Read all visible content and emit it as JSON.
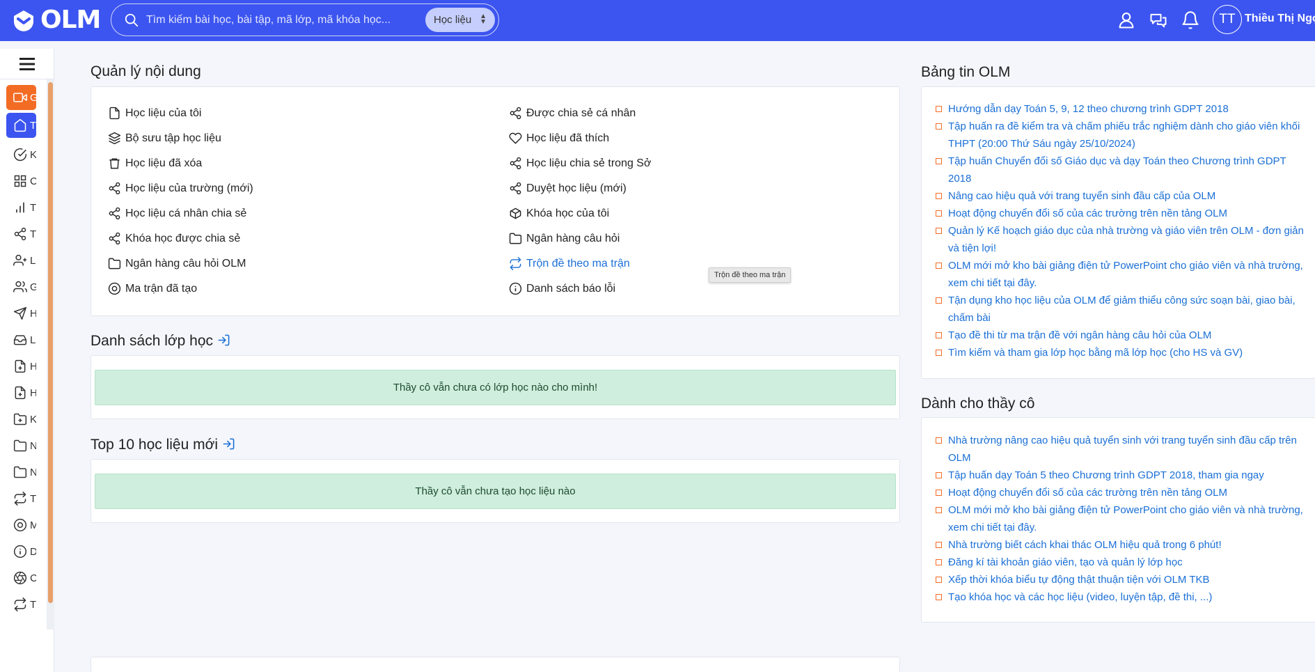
{
  "header": {
    "logo_text": "OLM",
    "search_placeholder": "Tìm kiếm bài học, bài tập, mã lớp, mã khóa học...",
    "search_scope": "Học liệu",
    "avatar_initials": "TT",
    "username": "Thiều Thị Ngọc"
  },
  "sidebar": {
    "items": [
      {
        "label": "G",
        "icon": "video-icon"
      },
      {
        "label": "T",
        "icon": "home-icon"
      },
      {
        "label": "K",
        "icon": "check-circle-icon"
      },
      {
        "label": "C",
        "icon": "grid-icon"
      },
      {
        "label": "T",
        "icon": "bar-chart-icon"
      },
      {
        "label": "T",
        "icon": "share-icon"
      },
      {
        "label": "L",
        "icon": "user-plus-icon"
      },
      {
        "label": "G",
        "icon": "users-icon"
      },
      {
        "label": "H",
        "icon": "send-icon"
      },
      {
        "label": "L",
        "icon": "inbox-icon"
      },
      {
        "label": "H",
        "icon": "file-plus-icon"
      },
      {
        "label": "H",
        "icon": "file-plus-icon"
      },
      {
        "label": "K",
        "icon": "folder-plus-icon"
      },
      {
        "label": "N",
        "icon": "folder-icon"
      },
      {
        "label": "N",
        "icon": "folder-icon"
      },
      {
        "label": "T",
        "icon": "shuffle-icon"
      },
      {
        "label": "M",
        "icon": "target-icon"
      },
      {
        "label": "D",
        "icon": "info-icon"
      },
      {
        "label": "C",
        "icon": "aperture-icon"
      },
      {
        "label": "T",
        "icon": "shuffle-icon"
      }
    ]
  },
  "content_mgmt": {
    "title": "Quản lý nội dung",
    "left": [
      {
        "label": "Học liệu của tôi",
        "icon": "file-icon"
      },
      {
        "label": "Bộ sưu tập học liệu",
        "icon": "layers-icon"
      },
      {
        "label": "Học liệu đã xóa",
        "icon": "trash-icon"
      },
      {
        "label": "Học liệu của trường (mới)",
        "icon": "share-icon"
      },
      {
        "label": "Học liệu cá nhân chia sẻ",
        "icon": "share-icon"
      },
      {
        "label": "Khóa học được chia sẻ",
        "icon": "share-icon"
      },
      {
        "label": "Ngân hàng câu hỏi OLM",
        "icon": "folder-icon"
      },
      {
        "label": "Ma trận đã tạo",
        "icon": "target-icon"
      }
    ],
    "right": [
      {
        "label": "Được chia sẻ cá nhân",
        "icon": "share-icon"
      },
      {
        "label": "Học liệu đã thích",
        "icon": "heart-icon"
      },
      {
        "label": "Học liệu chia sẻ trong Sở",
        "icon": "share-icon"
      },
      {
        "label": "Duyệt học liệu (mới)",
        "icon": "share-icon"
      },
      {
        "label": "Khóa học của tôi",
        "icon": "box-icon"
      },
      {
        "label": "Ngân hàng câu hỏi",
        "icon": "folder-icon"
      },
      {
        "label": "Trộn đề theo ma trận",
        "icon": "shuffle-icon"
      },
      {
        "label": "Danh sách báo lỗi",
        "icon": "info-icon"
      }
    ],
    "tooltip": "Trộn đề theo ma trận"
  },
  "classes": {
    "title": "Danh sách lớp học",
    "empty": "Thầy cô vẫn chưa có lớp học nào cho mình!"
  },
  "top10": {
    "title": "Top 10 học liệu mới",
    "empty": "Thầy cô vẫn chưa tạo học liệu nào"
  },
  "news": {
    "title": "Bảng tin OLM",
    "items": [
      "Hướng dẫn dạy Toán 5, 9, 12 theo chương trình GDPT 2018",
      "Tập huấn ra đề kiểm tra và chấm phiếu trắc nghiệm dành cho giáo viên khối THPT (20:00 Thứ Sáu ngày 25/10/2024)",
      "Tập huấn Chuyển đổi số Giáo dục và dạy Toán theo Chương trình GDPT 2018",
      "Nâng cao hiệu quả với trang tuyển sinh đầu cấp của OLM",
      "Hoạt động chuyển đổi số của các trường trên nền tảng OLM",
      "Quản lý Kế hoạch giáo dục của nhà trường và giáo viên trên OLM - đơn giản và tiện lợi!",
      "OLM mới mở kho bài giảng điện tử PowerPoint cho giáo viên và nhà trường, xem chi tiết tại đây.",
      "Tận dụng kho học liệu của OLM để giảm thiểu công sức soạn bài, giao bài, chấm bài",
      "Tạo đề thi từ ma trận đề với ngân hàng câu hỏi của OLM",
      "Tìm kiếm và tham gia lớp học bằng mã lớp học (cho HS và GV)"
    ]
  },
  "teachers": {
    "title": "Dành cho thầy cô",
    "items": [
      "Nhà trường nâng cao hiệu quả tuyển sinh với trang tuyển sinh đầu cấp trên OLM",
      "Tập huấn dạy Toán 5 theo Chương trình GDPT 2018, tham gia ngay",
      "Hoạt động chuyển đổi số của các trường trên nền tảng OLM",
      "OLM mới mở kho bài giảng điện tử PowerPoint cho giáo viên và nhà trường, xem chi tiết tại đây.",
      "Nhà trường biết cách khai thác OLM hiệu quả trong 6 phút!",
      "Đăng kí tài khoản giáo viên, tạo và quản lý lớp học",
      "Xếp thời khóa biểu tự động thật thuận tiện với OLM TKB",
      "Tạo khóa học và các học liệu (video, luyện tập, đề thi, ...)"
    ]
  },
  "colors": {
    "brand_blue": "#3c55f0",
    "accent_orange": "#f36c24",
    "link_blue": "#1a6fd6",
    "success_bg": "#cfeedd"
  }
}
